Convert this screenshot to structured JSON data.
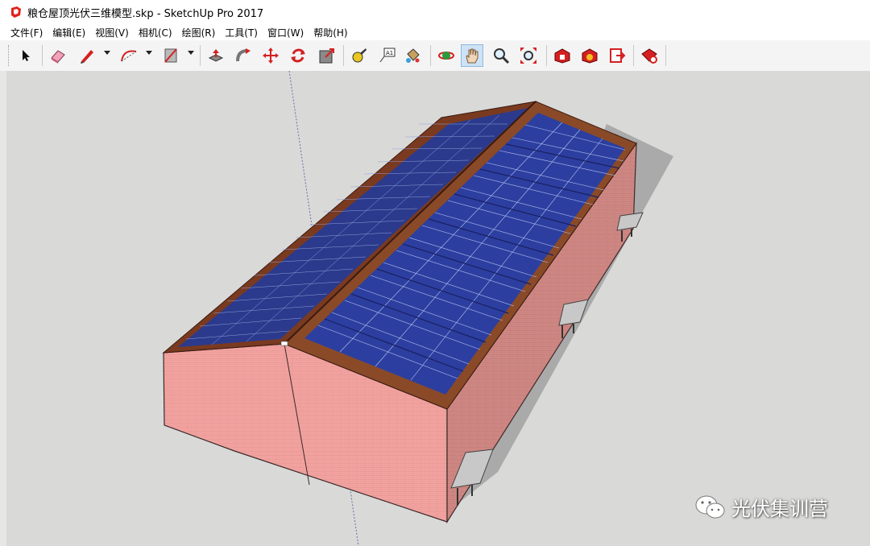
{
  "window": {
    "title": "粮仓屋顶光伏三维模型.skp - SketchUp Pro 2017",
    "app_icon": "sketchup-icon"
  },
  "menu": [
    "文件(F)",
    "编辑(E)",
    "视图(V)",
    "相机(C)",
    "绘图(R)",
    "工具(T)",
    "窗口(W)",
    "帮助(H)"
  ],
  "toolbar": {
    "tools": [
      "select-arrow-icon",
      "eraser-icon",
      "pencil-line-icon",
      "arc-icon",
      "rectangle-icon",
      "push-pull-icon",
      "follow-me-icon",
      "move-icon",
      "rotate-icon",
      "scale-icon",
      "tape-measure-icon",
      "text-label-icon",
      "paint-bucket-icon",
      "orbit-icon",
      "pan-hand-icon",
      "zoom-icon",
      "zoom-extents-icon",
      "3d-warehouse-icon",
      "extension-warehouse-icon",
      "send-to-layout-icon",
      "extension-manager-icon"
    ],
    "active_tool": "pan-hand-icon"
  },
  "viewport": {
    "background": "#d9d9d8",
    "model": "grain-warehouse-with-rooftop-solar-panels"
  },
  "watermark": {
    "text": "光伏集训营",
    "icon": "wechat-icon"
  }
}
